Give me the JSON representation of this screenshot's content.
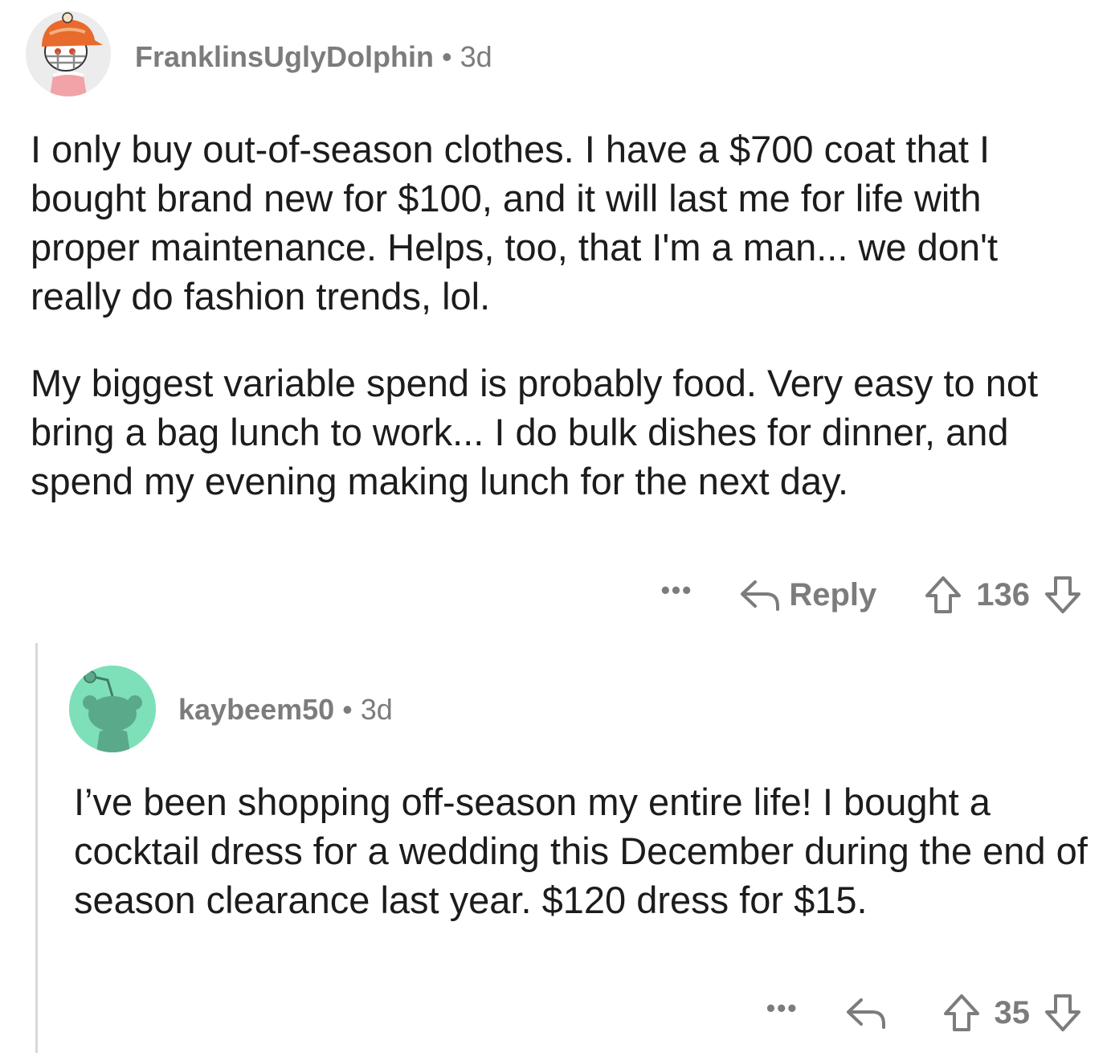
{
  "comments": [
    {
      "username": "FranklinsUglyDolphin",
      "separator": "•",
      "age": "3d",
      "avatar_icon": "helmet-character-avatar-icon",
      "paragraphs": [
        "I only buy out-of-season clothes.  I have a $700 coat that I bought brand new for $100, and it will last me for life with proper maintenance.  Helps, too, that I'm a man... we don't really do fashion trends, lol.",
        "My biggest variable spend is probably food.  Very easy to not bring a bag lunch to work... I do bulk dishes for dinner, and spend my evening making lunch for the next day."
      ],
      "more_label": "•••",
      "reply_label": "Reply",
      "score": "136"
    },
    {
      "username": "kaybeem50",
      "separator": "•",
      "age": "3d",
      "avatar_icon": "snoo-avatar-icon",
      "avatar_color": "#7ee0b8",
      "paragraphs": [
        "I’ve been shopping off-season my entire life! I bought a cocktail dress for a wedding this December during the end of season clearance last year. $120 dress for $15."
      ],
      "more_label": "•••",
      "score": "35"
    }
  ],
  "colors": {
    "meta_text": "#7c7c7c",
    "body_text": "#1c1c1c",
    "thread_line": "#d8d8d8"
  }
}
